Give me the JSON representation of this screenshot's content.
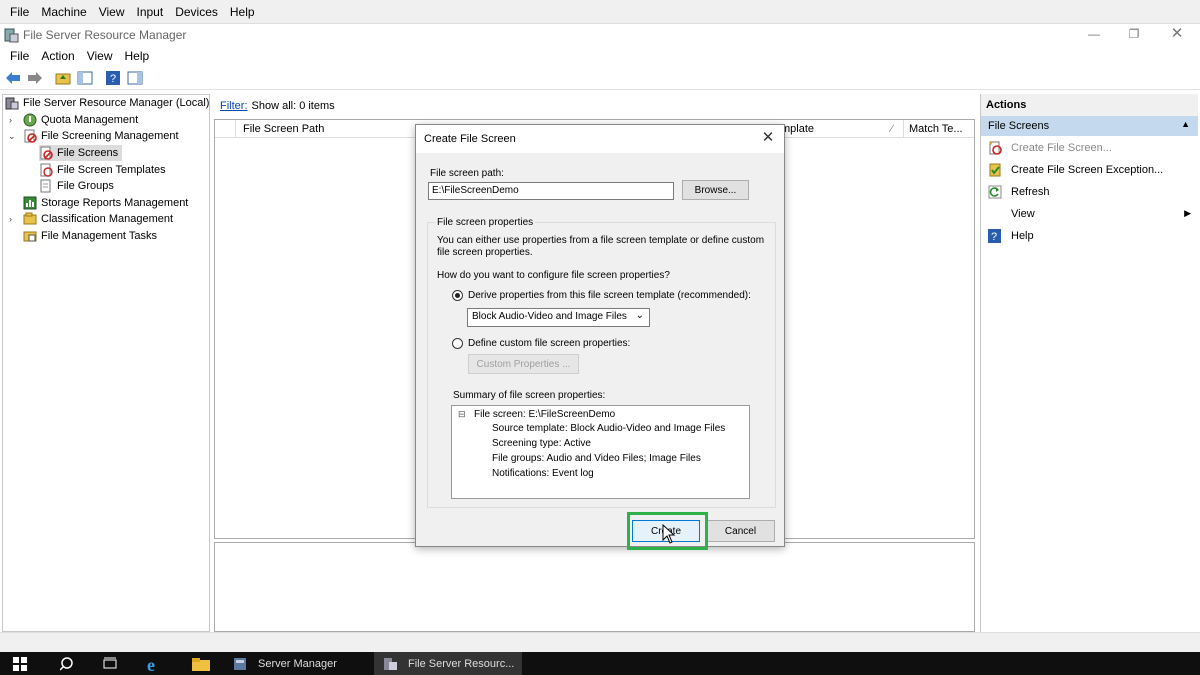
{
  "host_menu": [
    "File",
    "Machine",
    "View",
    "Input",
    "Devices",
    "Help"
  ],
  "window": {
    "title": "File Server Resource Manager"
  },
  "app_menu": [
    "File",
    "Action",
    "View",
    "Help"
  ],
  "tree": {
    "root": "File Server Resource Manager (Local)",
    "quota": "Quota Management",
    "screening": "File Screening Management",
    "file_screens": "File Screens",
    "file_screen_templates": "File Screen Templates",
    "file_groups": "File Groups",
    "storage_reports": "Storage Reports Management",
    "classification": "Classification Management",
    "file_management_tasks": "File Management Tasks"
  },
  "filter": {
    "link": "Filter:",
    "text": "Show all: 0 items"
  },
  "columns": {
    "path": "File Screen Path",
    "template": "mplate",
    "match": "Match Te..."
  },
  "actions": {
    "header": "Actions",
    "section": "File Screens",
    "items": [
      "Create File Screen...",
      "Create File Screen Exception...",
      "Refresh",
      "View",
      "Help"
    ]
  },
  "dialog": {
    "title": "Create File Screen",
    "path_label": "File screen path:",
    "path_value": "E:\\FileScreenDemo",
    "browse": "Browse...",
    "group_label": "File screen properties",
    "description": "You can either use properties from a file screen template or define custom file screen properties.",
    "question": "How do you want to configure file screen properties?",
    "option_template": "Derive properties from this file screen template (recommended):",
    "template_value": "Block Audio-Video and Image Files",
    "option_custom": "Define custom file screen properties:",
    "custom_button": "Custom Properties ...",
    "summary_label": "Summary of file screen properties:",
    "summary_root": "File screen: E:\\FileScreenDemo",
    "summary_items": [
      "Source template: Block Audio-Video and Image Files",
      "Screening type: Active",
      "File groups: Audio and Video Files; Image Files",
      "Notifications: Event log"
    ],
    "create": "Create",
    "cancel": "Cancel"
  },
  "taskbar": {
    "server_manager": "Server Manager",
    "fsrm": "File Server Resourc..."
  }
}
